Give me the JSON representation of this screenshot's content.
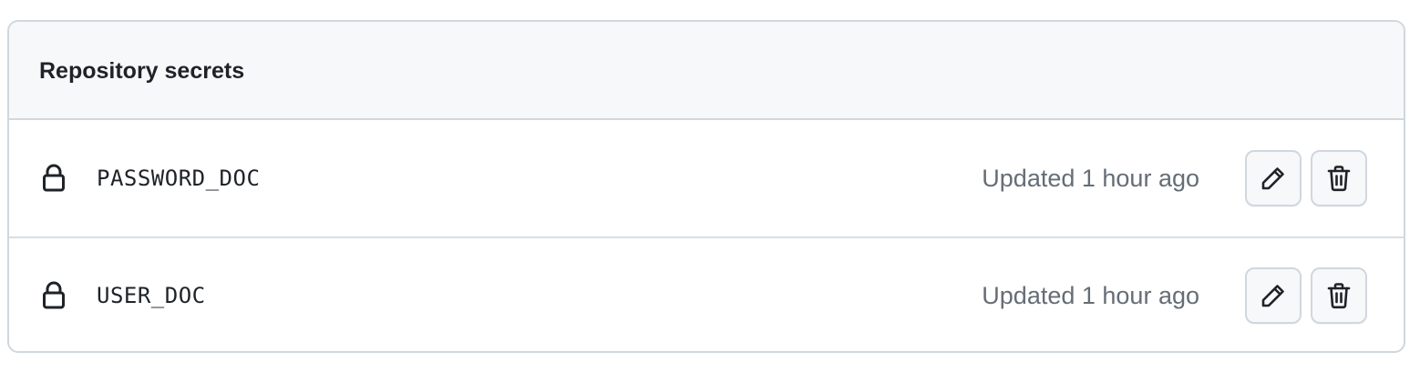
{
  "header": {
    "title": "Repository secrets"
  },
  "secrets": [
    {
      "name": "PASSWORD_DOC",
      "updated": "Updated 1 hour ago",
      "icon": "lock-icon"
    },
    {
      "name": "USER_DOC",
      "updated": "Updated 1 hour ago",
      "icon": "lock-icon"
    }
  ],
  "actions": {
    "edit_icon": "pencil-icon",
    "delete_icon": "trash-icon"
  },
  "colors": {
    "border": "#d0d7de",
    "header_bg": "#f6f8fa",
    "text": "#1f2328",
    "muted": "#656d76"
  }
}
